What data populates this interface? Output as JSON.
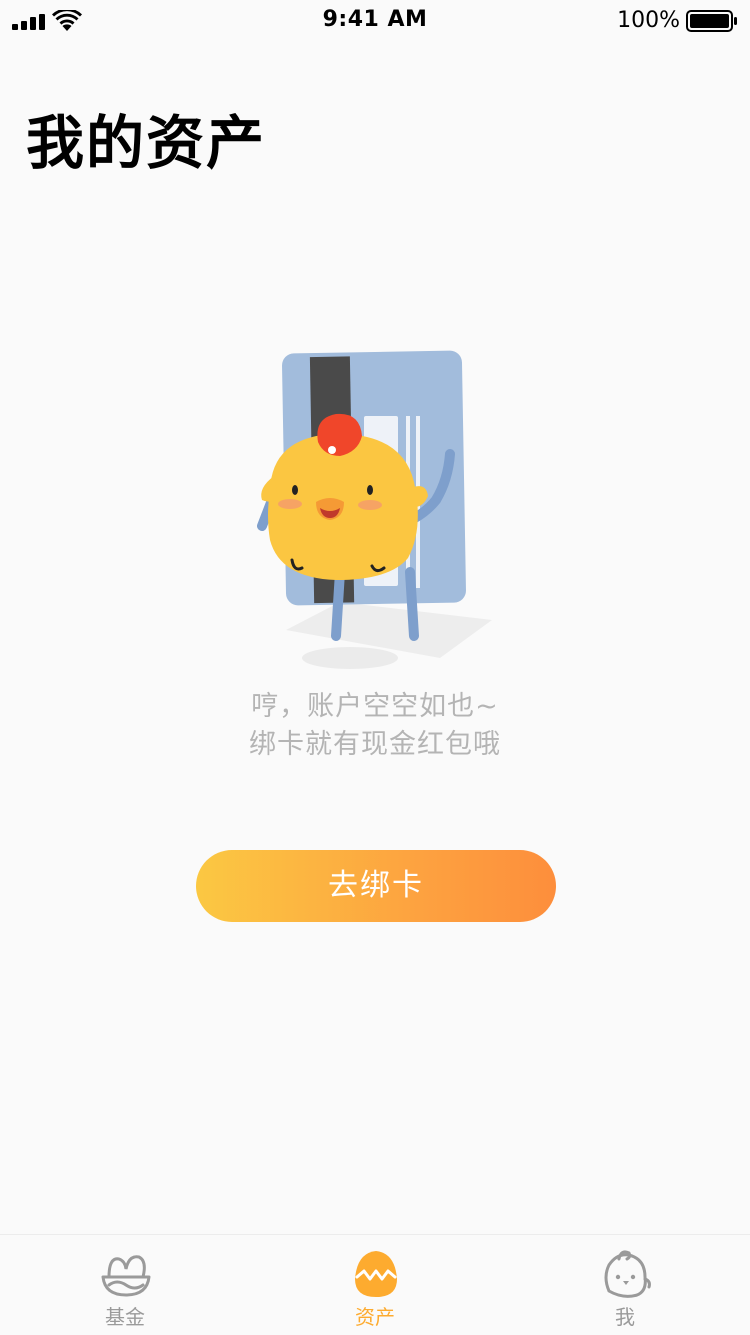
{
  "status_bar": {
    "time": "9:41 AM",
    "battery_percent": "100%",
    "icons": [
      "signal-icon",
      "wifi-icon",
      "battery-icon"
    ]
  },
  "page": {
    "title": "我的资产"
  },
  "empty_state": {
    "illustration": "chick-holding-bank-card",
    "line1": "哼，账户空空如也~",
    "line2": "绑卡就有现金红包哦"
  },
  "bind_button": {
    "label": "去绑卡"
  },
  "tab_bar": {
    "active_color": "#fdab2f",
    "inactive_color": "#9a9a9a",
    "tabs": [
      {
        "label": "基金",
        "icon": "fund-basket-icon",
        "active": false
      },
      {
        "label": "资产",
        "icon": "egg-icon",
        "active": true
      },
      {
        "label": "我",
        "icon": "chick-face-icon",
        "active": false
      }
    ]
  },
  "colors": {
    "button_gradient_start": "#fbc842",
    "button_gradient_end": "#fd8e3c",
    "background": "#fafafa"
  }
}
